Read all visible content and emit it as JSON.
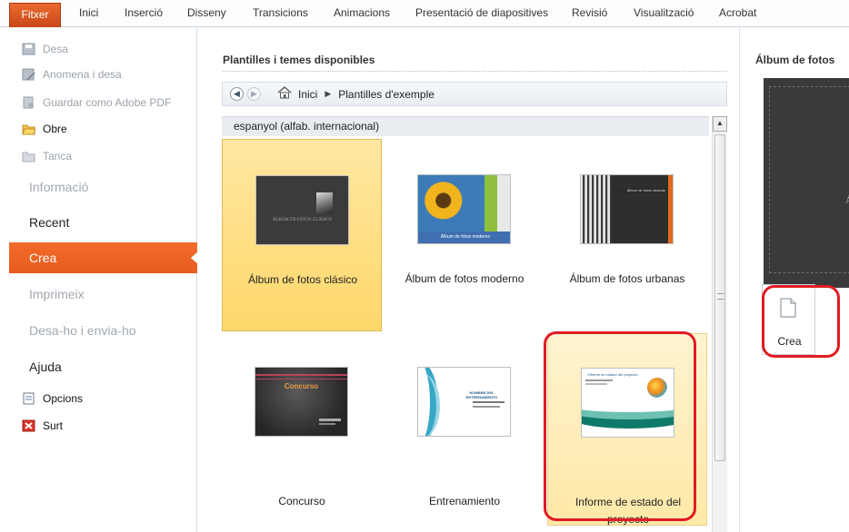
{
  "ribbon": {
    "tabs": [
      {
        "label": "Fitxer"
      },
      {
        "label": "Inici"
      },
      {
        "label": "Inserció"
      },
      {
        "label": "Disseny"
      },
      {
        "label": "Transicions"
      },
      {
        "label": "Animacions"
      },
      {
        "label": "Presentació de diapositives"
      },
      {
        "label": "Revisió"
      },
      {
        "label": "Visualització"
      },
      {
        "label": "Acrobat"
      }
    ]
  },
  "leftnav": {
    "small_items": [
      {
        "label": "Desa",
        "icon": "save-icon"
      },
      {
        "label": "Anomena i desa",
        "icon": "save-as-icon"
      },
      {
        "label": "Guardar como Adobe PDF",
        "icon": "pdf-icon"
      },
      {
        "label": "Obre",
        "icon": "folder-open-icon"
      },
      {
        "label": "Tanca",
        "icon": "folder-close-icon"
      }
    ],
    "big_items": [
      {
        "label": "Informació"
      },
      {
        "label": "Recent"
      },
      {
        "label": "Crea"
      },
      {
        "label": "Imprimeix"
      },
      {
        "label": "Desa-ho i envia-ho"
      },
      {
        "label": "Ajuda"
      }
    ],
    "bottom_items": [
      {
        "label": "Opcions",
        "icon": "options-icon"
      },
      {
        "label": "Surt",
        "icon": "exit-icon"
      }
    ]
  },
  "main": {
    "title": "Plantilles i temes disponibles",
    "breadcrumb": {
      "home": "Inici",
      "current": "Plantilles d'exemple"
    },
    "group": "espanyol (alfab. internacional)",
    "templates": [
      {
        "label": "Álbum de fotos clásico",
        "thumb_text": "ÁLBUM DE FOTOS CLÁSICO"
      },
      {
        "label": "Álbum de fotos moderno",
        "thumb_text": "Álbum de fotos moderno"
      },
      {
        "label": "Álbum de fotos urbanas",
        "thumb_text": "Álbum de fotos urbanas"
      },
      {
        "label": "Concurso",
        "thumb_text": "Concurso"
      },
      {
        "label": "Entrenamiento",
        "thumb_text": "NOMBRE DEL ENTRENAMIENTO"
      },
      {
        "label": "Informe de estado del proyecto",
        "thumb_text": "Informe de estado del proyecto"
      }
    ]
  },
  "preview": {
    "title": "Álbum de fotos",
    "image_text": "ÁL",
    "create_label": "Crea"
  },
  "colors": {
    "file_tab": "#d9531e",
    "selected_nav": "#f0652a",
    "selected_tile": "#ffd96e",
    "annotation": "#e21b24"
  }
}
